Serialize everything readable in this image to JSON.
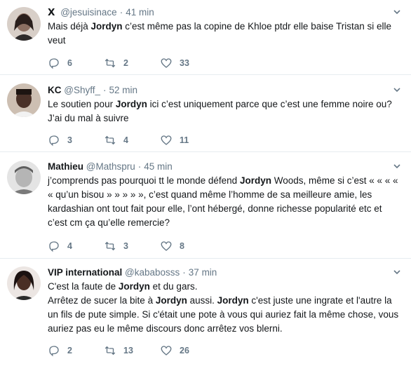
{
  "tweets": [
    {
      "name_icon": "𝗫",
      "name": "",
      "handle": "@jesuisinace",
      "time": "41 min",
      "segments": [
        {
          "t": "Mais déjà "
        },
        {
          "t": "Jordyn",
          "b": true
        },
        {
          "t": " c’est même pas la copine de Khloe ptdr elle baise Tristan si elle veut"
        }
      ],
      "replies": "6",
      "retweets": "2",
      "likes": "33",
      "avatar_color": "#5b4a45"
    },
    {
      "name": "KC",
      "handle": "@Shyff_",
      "time": "52 min",
      "segments": [
        {
          "t": "Le soutien pour "
        },
        {
          "t": "Jordyn",
          "b": true
        },
        {
          "t": " ici c’est uniquement parce que c’est une femme noire ou? J’ai du mal à suivre"
        }
      ],
      "replies": "3",
      "retweets": "4",
      "likes": "11",
      "avatar_color": "#3a2a24"
    },
    {
      "name": "Mathieu",
      "handle": "@Mathspru",
      "time": "45 min",
      "segments": [
        {
          "t": "j’comprends pas pourquoi tt le monde défend "
        },
        {
          "t": "Jordyn",
          "b": true
        },
        {
          "t": " Woods, même si c’est « « « « « qu’un bisou » » » » », c’est quand même l’homme de sa meilleure amie, les kardashian ont tout fait pour elle, l’ont hébergé, donne richesse popularité etc et c’est cm ça qu’elle remercie?"
        }
      ],
      "replies": "4",
      "retweets": "3",
      "likes": "8",
      "avatar_color": "#9a9a9a"
    },
    {
      "name": "VIP international",
      "handle": "@kababosss",
      "time": "37 min",
      "segments": [
        {
          "t": "C'est la faute de "
        },
        {
          "t": "Jordyn",
          "b": true
        },
        {
          "t": " et du gars.\nArrêtez de sucer la bite à "
        },
        {
          "t": "Jordyn",
          "b": true
        },
        {
          "t": " aussi. "
        },
        {
          "t": "Jordyn",
          "b": true
        },
        {
          "t": " c'est juste une ingrate et l'autre la un fils de pute simple. Si c'était une pote à vous qui auriez fait la même chose, vous auriez pas eu le même discours donc arrêtez vos blerni."
        }
      ],
      "replies": "2",
      "retweets": "13",
      "likes": "26",
      "avatar_color": "#2b1c18"
    }
  ]
}
